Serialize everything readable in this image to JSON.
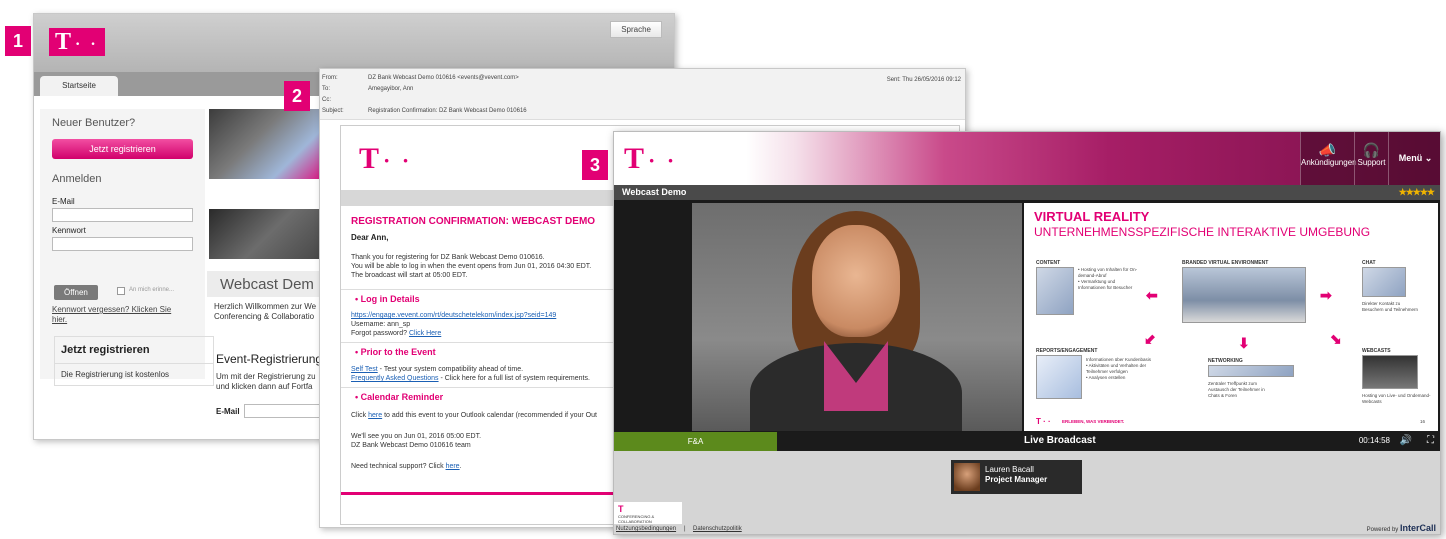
{
  "badges": [
    "1",
    "2",
    "3"
  ],
  "brand": {
    "logo_t": "T",
    "logo_dots": "· ·",
    "accent": "#e20074"
  },
  "screen1": {
    "sprache": "Sprache",
    "tab": "Startseite",
    "neuer_benutzer": "Neuer Benutzer?",
    "jetzt_registrieren_btn": "Jetzt registrieren",
    "anmelden": "Anmelden",
    "email_label": "E-Mail",
    "kennwort_label": "Kennwort",
    "offnen_btn": "Öffnen",
    "remember": "An mich erinne...",
    "forgot": "Kennwort vergessen? Klicken Sie hier.",
    "jetzt_box_title": "Jetzt registrieren",
    "jetzt_box_text": "Die Registrierung ist kostenlos",
    "webcast_title": "Webcast Dem",
    "willkommen": "Herzlich Willkommen zur We Conferencing & Collaboratio",
    "event_reg": "Event-Registrierung",
    "event_text": "Um mit der Registrierung zu und klicken dann auf Fortfa",
    "email_field_label": "E-Mail"
  },
  "screen2": {
    "from_k": "From:",
    "from_v": "DZ Bank Webcast Demo 010616 <events@vevent.com>",
    "to_k": "To:",
    "to_v": "Amegayibor, Ann",
    "cc_k": "Cc:",
    "cc_v": "",
    "subject_k": "Subject:",
    "subject_v": "Registration Confirmation: DZ Bank Webcast Demo 010616",
    "sent": "Sent:  Thu 26/05/2016 09:12",
    "heading": "REGISTRATION CONFIRMATION: WEBCAST DEMO",
    "dear": "Dear Ann,",
    "p1": "Thank you for registering for DZ Bank Webcast Demo 010616.",
    "p2": "You will be able to log in when the event opens from Jun 01, 2016 04:30 EDT.",
    "p3": "The broadcast will start at 05:00 EDT.",
    "sec_login": "• Log in Details",
    "login_link": "https://engage.vevent.com/rt/deutschetelekom/index.jsp?seid=149",
    "username": "Username: ann_sp",
    "forgot_prefix": "Forgot password? ",
    "forgot_link": "Click Here",
    "sec_prior": "• Prior to the Event",
    "self_test_link": "Self Test",
    "self_test_text": " - Test your system compatibility ahead of time.",
    "faq_link": "Frequently Asked Questions",
    "faq_text": " - Click here for a full list of system requirements.",
    "sec_cal": "• Calendar Reminder",
    "cal_prefix": "Click ",
    "cal_link": "here",
    "cal_text": " to add this event to your Outlook calendar (recommended if your Out",
    "see_you": "We'll see you on Jun 01, 2016 05:00 EDT.",
    "team": "DZ Bank Webcast Demo 010616 team",
    "support_prefix": "Need technical support? Click ",
    "support_link": "here",
    "support_suffix": "."
  },
  "screen3": {
    "nav_ankuendigungen": "Ankündigungen",
    "nav_support": "Support",
    "nav_menu": "Menü ⌄",
    "title": "Webcast Demo",
    "stars": "★★★★★",
    "slide": {
      "title": "VIRTUAL REALITY",
      "subtitle": "UNTERNEHMENSSPEZIFISCHE INTERAKTIVE UMGEBUNG",
      "content": "CONTENT",
      "content_body": "• Hosting von Inhalten für On-demand-Abruf\n• Vermarktung und Informationen für Besucher",
      "bve": "BRANDED VIRTUAL ENVIRONMENT",
      "chat": "CHAT",
      "chat_body": "Direkter Kontakt zu Besuchern und Teilnehmern",
      "reports": "REPORTS/ENGAGEMENT",
      "reports_body": "Informationen über Kundenbasis\n• Aktivitäten und Verhalten der Teilnehmer verfolgen\n• Analysen erstellen",
      "networking": "NETWORKING",
      "networking_body": "Zentraler Treffpunkt zum Austausch der Teilnehmer in Chats & Foren",
      "webcasts": "WEBCASTS",
      "webcasts_body": "Hosting von Live- und Ondemand-Webcasts",
      "footer_tag": "ERLEBEN, WAS VERBINDET.",
      "page_num": "16"
    },
    "tab_fa": "F&A",
    "live": "Live Broadcast",
    "time": "00:14:58",
    "speaker_name": "Lauren Bacall",
    "speaker_role": "Project Manager",
    "mini_logo_text": "CONFERENCING & COLLABORATION",
    "footer_terms": "Nutzungsbedingungen",
    "footer_sep": "|",
    "footer_privacy": "Datenschutzpolitik",
    "powered_by": "Powered by",
    "intercall": "InterCall"
  }
}
